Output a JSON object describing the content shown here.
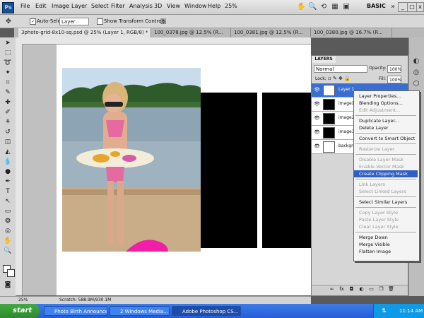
{
  "app": {
    "logo": "Ps",
    "workspace": "BASIC"
  },
  "menu": [
    "File",
    "Edit",
    "Image",
    "Layer",
    "Select",
    "Filter",
    "Analysis",
    "3D",
    "View",
    "Window",
    "Help"
  ],
  "zoom": "25%",
  "options": {
    "auto_select_label": "Auto-Select:",
    "auto_select_value": "Layer",
    "transform_label": "Show Transform Controls"
  },
  "tabs": [
    {
      "label": "3photo-grid-8x10-sq.psd @ 25% (Layer 1, RGB/8) *"
    },
    {
      "label": "100_0378.jpg @ 12.5% (R..."
    },
    {
      "label": "100_0381.jpg @ 12.5% (R..."
    },
    {
      "label": "100_0380.jpg @ 16.7% (R..."
    }
  ],
  "status": {
    "zoom": "25%",
    "scratch": "Scratch: 588.9M/930.1M"
  },
  "layers_panel": {
    "title": "LAYERS",
    "blend_mode": "Normal",
    "opacity_label": "Opacity:",
    "opacity_value": "100%",
    "lock_label": "Lock:",
    "fill_label": "Fill:",
    "fill_value": "100%",
    "layers": [
      {
        "name": "Layer 1",
        "selected": true
      },
      {
        "name": "image1",
        "selected": false
      },
      {
        "name": "image2",
        "selected": false
      },
      {
        "name": "image3",
        "selected": false
      },
      {
        "name": "backgro",
        "selected": false
      }
    ]
  },
  "context_menu": {
    "items": [
      {
        "label": "Layer Properties...",
        "enabled": true
      },
      {
        "label": "Blending Options...",
        "enabled": true
      },
      {
        "label": "Edit Adjustment...",
        "enabled": false
      },
      {
        "sep": true
      },
      {
        "label": "Duplicate Layer...",
        "enabled": true
      },
      {
        "label": "Delete Layer",
        "enabled": true
      },
      {
        "sep": true
      },
      {
        "label": "Convert to Smart Object",
        "enabled": true
      },
      {
        "sep": true
      },
      {
        "label": "Rasterize Layer",
        "enabled": false
      },
      {
        "sep": true
      },
      {
        "label": "Disable Layer Mask",
        "enabled": false
      },
      {
        "label": "Enable Vector Mask",
        "enabled": false
      },
      {
        "label": "Create Clipping Mask",
        "enabled": true,
        "highlighted": true
      },
      {
        "sep": true
      },
      {
        "label": "Link Layers",
        "enabled": false
      },
      {
        "label": "Select Linked Layers",
        "enabled": false
      },
      {
        "sep": true
      },
      {
        "label": "Select Similar Layers",
        "enabled": true
      },
      {
        "sep": true
      },
      {
        "label": "Copy Layer Style",
        "enabled": false
      },
      {
        "label": "Paste Layer Style",
        "enabled": false
      },
      {
        "label": "Clear Layer Style",
        "enabled": false
      },
      {
        "sep": true
      },
      {
        "label": "Merge Down",
        "enabled": true
      },
      {
        "label": "Merge Visible",
        "enabled": true
      },
      {
        "label": "Flatten Image",
        "enabled": true
      }
    ]
  },
  "taskbar": {
    "start": "start",
    "tasks": [
      {
        "label": "Photo Birth Announce...",
        "active": false
      },
      {
        "label": "2 Windows Media...",
        "active": false
      },
      {
        "label": "Adobe Photoshop CS...",
        "active": true
      }
    ],
    "clock": "11:14 AM"
  },
  "colors": {
    "selection": "#3a6fd1",
    "menu_highlight": "#2f5ec4",
    "taskbar": "#245edb"
  }
}
